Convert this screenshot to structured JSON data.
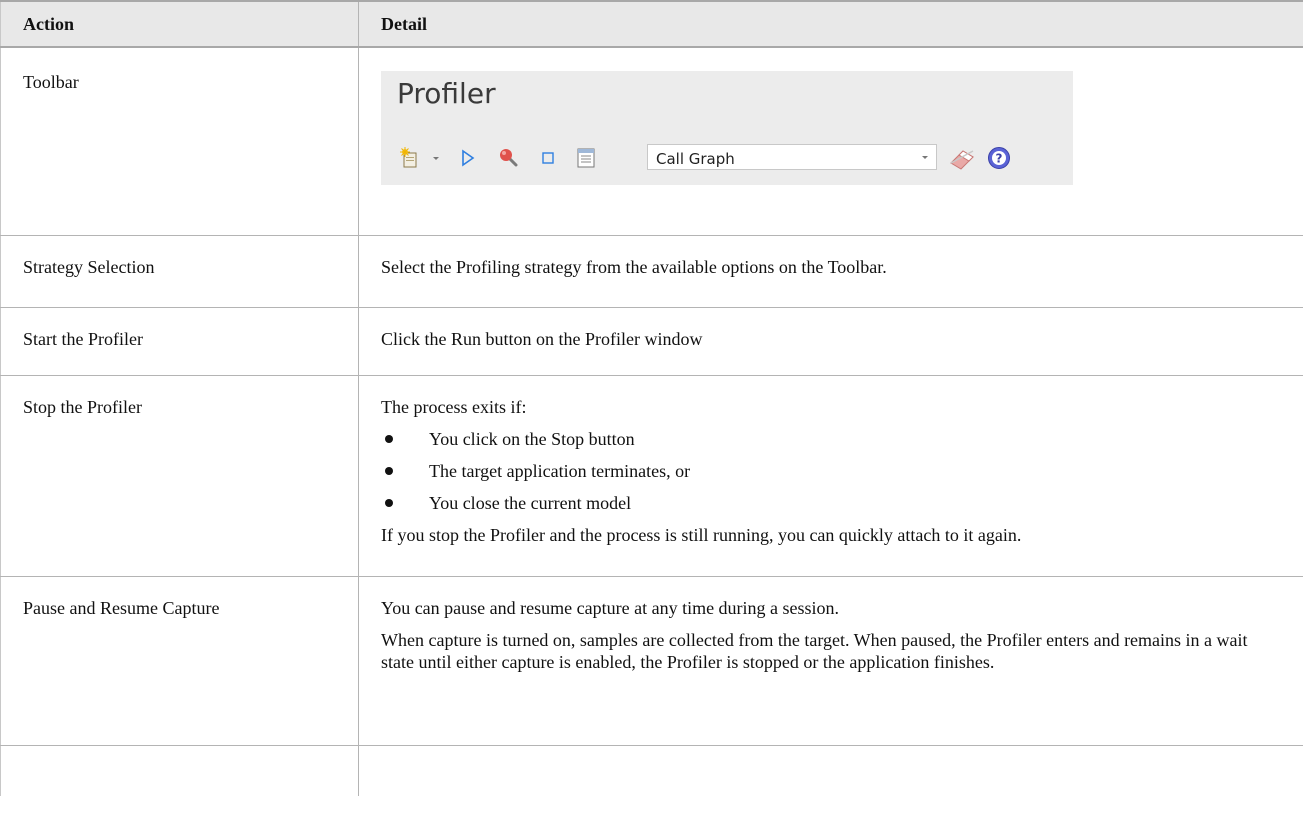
{
  "table": {
    "headers": {
      "action": "Action",
      "detail": "Detail"
    },
    "rows": {
      "toolbar": {
        "action": "Toolbar"
      },
      "strategy": {
        "action": "Strategy Selection",
        "detail": "Select the Profiling strategy from the available options on the Toolbar."
      },
      "start": {
        "action": "Start the Profiler",
        "detail": "Click the Run button on the Profiler window"
      },
      "stop": {
        "action": "Stop the Profiler",
        "intro": "The process exits if:",
        "bullets": [
          "You click on the Stop button",
          "The target application terminates, or",
          "You close the current model"
        ],
        "outro": "If you stop the Profiler and the process is still running, you can quickly attach to it again."
      },
      "pause": {
        "action": "Pause and Resume Capture",
        "para1": "You can pause and resume capture at any time during a session.",
        "para2": "When capture is turned on, samples are collected from the target. When paused, the Profiler enters and remains in a wait state until either capture is enabled, the Profiler is stopped or the application finishes."
      }
    }
  },
  "profiler": {
    "title": "Profiler",
    "strategy_value": "Call Graph",
    "icons": [
      "new-profile-icon",
      "dropdown-arrow-icon",
      "run-icon",
      "attach-icon",
      "stop-icon",
      "report-icon",
      "clear-icon",
      "help-icon"
    ]
  }
}
